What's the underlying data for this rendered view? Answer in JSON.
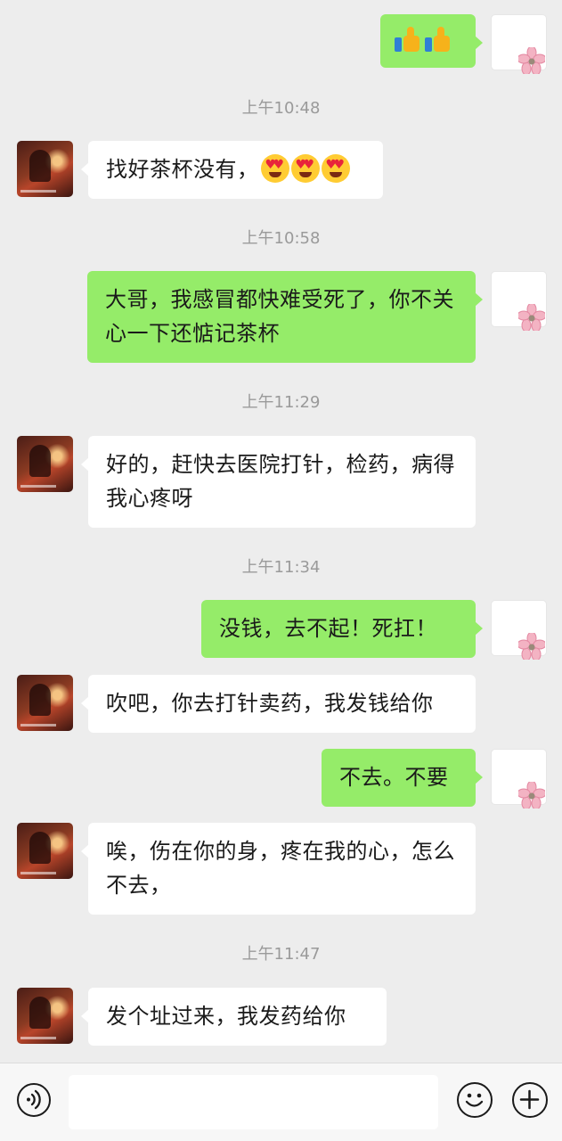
{
  "messages": [
    {
      "side": "right",
      "type": "emoji",
      "emojis": [
        "thumbs-up",
        "thumbs-up"
      ]
    },
    {
      "type": "time",
      "text": "上午10:48"
    },
    {
      "side": "left",
      "type": "text",
      "text": "找好茶杯没有，",
      "emojis": [
        "heart-eyes",
        "heart-eyes",
        "heart-eyes"
      ]
    },
    {
      "type": "time",
      "text": "上午10:58"
    },
    {
      "side": "right",
      "type": "text",
      "text": "大哥，我感冒都快难受死了，你不关心一下还惦记茶杯"
    },
    {
      "type": "time",
      "text": "上午11:29"
    },
    {
      "side": "left",
      "type": "text",
      "text": "好的，赶快去医院打针，检药，病得我心疼呀"
    },
    {
      "type": "time",
      "text": "上午11:34"
    },
    {
      "side": "right",
      "type": "text",
      "text": "没钱，去不起！死扛！"
    },
    {
      "side": "left",
      "type": "text",
      "text": "吹吧，你去打针卖药，我发钱给你"
    },
    {
      "side": "right",
      "type": "text",
      "text": "不去。不要"
    },
    {
      "side": "left",
      "type": "text",
      "text": "唉，伤在你的身，疼在我的心，怎么不去，"
    },
    {
      "type": "time",
      "text": "上午11:47"
    },
    {
      "side": "left",
      "type": "text",
      "text": "发个址过来，我发药给你"
    }
  ],
  "input_bar": {
    "voice_icon": "voice-icon",
    "text_value": "",
    "emoji_icon": "emoji-icon",
    "more_icon": "plus-icon"
  },
  "colors": {
    "background": "#ededed",
    "sent_bubble": "#95ec69",
    "received_bubble": "#ffffff",
    "timestamp": "#9a9a9a"
  }
}
